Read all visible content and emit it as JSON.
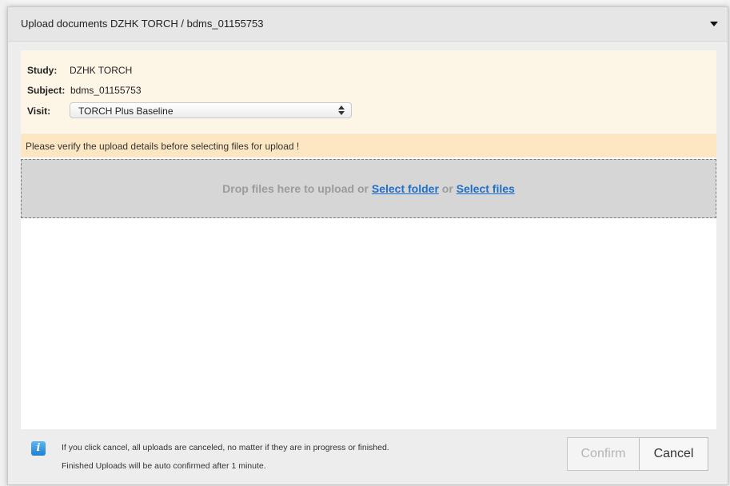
{
  "dialog": {
    "title": "Upload documents DZHK TORCH / bdms_01155753"
  },
  "details": {
    "study_label": "Study:",
    "study_value": "DZHK TORCH",
    "subject_label": "Subject:",
    "subject_value": "bdms_01155753",
    "visit_label": "Visit:",
    "visit_selected": "TORCH Plus Baseline"
  },
  "warning": "Please verify the upload details before selecting files for upload !",
  "dropzone": {
    "text": "Drop files here to upload or",
    "select_folder": "Select folder",
    "or": "or",
    "select_files": "Select files"
  },
  "footer": {
    "info_line1": "If you click cancel, all uploads are canceled, no matter if they are in progress or finished.",
    "info_line2": "Finished Uploads will be auto confirmed after 1 minute.",
    "confirm_label": "Confirm",
    "cancel_label": "Cancel"
  },
  "icons": {
    "header_caret": "chevron-down-icon",
    "select_arrows": "updown-icon",
    "info": "info-icon"
  },
  "colors": {
    "details_bg": "#fdf6e7",
    "warning_bg": "#fde7c2",
    "link": "#1f6fc9",
    "dropzone_bg": "#d6d6d6"
  }
}
